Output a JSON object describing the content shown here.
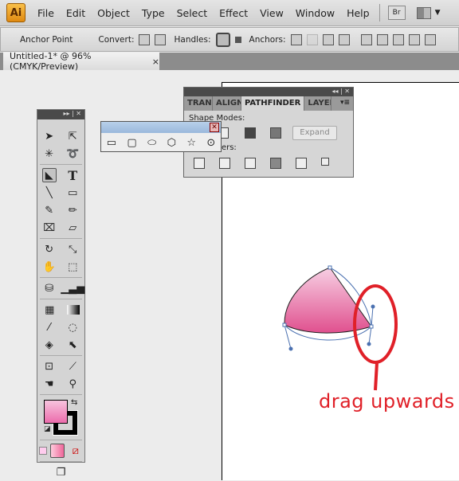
{
  "app": {
    "logo": "Ai",
    "menu": [
      "File",
      "Edit",
      "Object",
      "Type",
      "Select",
      "Effect",
      "View",
      "Window",
      "Help"
    ],
    "bridge_label": "Br"
  },
  "control_bar": {
    "tool_name": "Anchor Point",
    "convert_label": "Convert:",
    "handles_label": "Handles:",
    "anchors_label": "Anchors:"
  },
  "document_tab": {
    "title": "Untitled-1* @ 96% (CMYK/Preview)",
    "close": "×"
  },
  "pathfinder_panel": {
    "tabs": [
      "TRAN",
      "ALIGN",
      "PATHFINDER",
      "LAYEF"
    ],
    "active_tab": "PATHFINDER",
    "shape_modes_label": "Shape Modes:",
    "pathfinders_label": "Pathfinders:",
    "expand_label": "Expand"
  },
  "shapes_panel": {
    "tools": [
      "rectangle",
      "rounded-rectangle",
      "ellipse",
      "polygon",
      "star",
      "flare"
    ]
  },
  "toolbox": {
    "fill_color": "#f08cc0",
    "stroke_color": "#000000"
  },
  "annotation": {
    "text": "drag upwards",
    "color": "#e02028"
  }
}
